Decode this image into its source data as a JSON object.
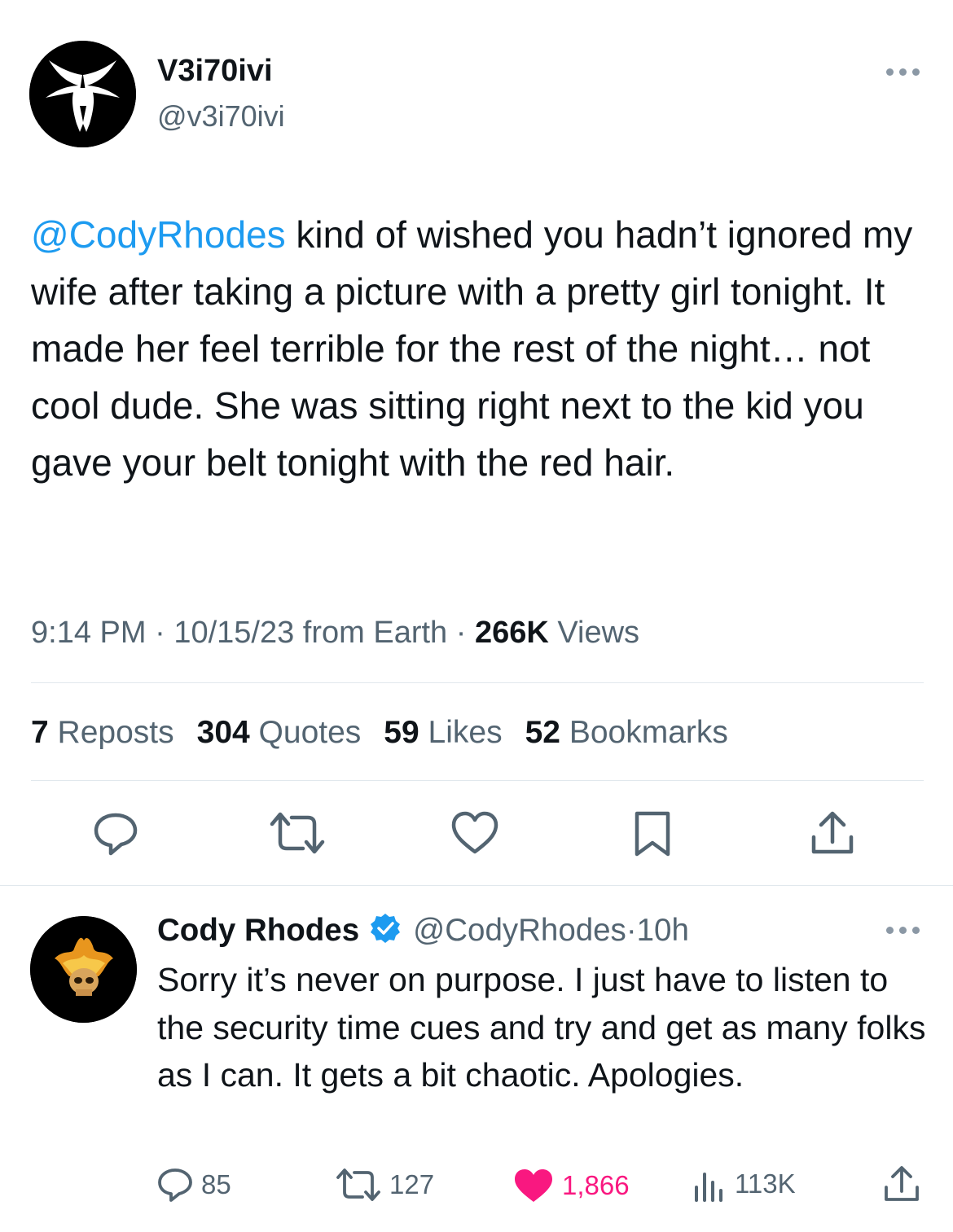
{
  "main_tweet": {
    "display_name": "V3i70ivi",
    "handle": "@v3i70ivi",
    "mention": "@CodyRhodes",
    "text": " kind of wished you hadn’t ignored my wife after taking a picture with a pretty girl tonight. It made her feel terrible for the rest of the night… not cool dude. She was sitting right next to the kid you gave your belt tonight with the red hair.",
    "time": "9:14 PM",
    "sep1": " · ",
    "date": "10/15/23",
    "source": " from Earth",
    "sep2": " · ",
    "views_count": "266K",
    "views_label": " Views",
    "stats": {
      "reposts_count": "7",
      "reposts_label": "Reposts",
      "quotes_count": "304",
      "quotes_label": "Quotes",
      "likes_count": "59",
      "likes_label": "Likes",
      "bookmarks_count": "52",
      "bookmarks_label": "Bookmarks"
    },
    "actions": [
      "reply-icon",
      "repost-icon",
      "like-icon",
      "bookmark-icon",
      "share-icon"
    ]
  },
  "reply": {
    "display_name": "Cody Rhodes",
    "verified": true,
    "handle": "@CodyRhodes",
    "sep": " · ",
    "time_ago": "10h",
    "text": "Sorry it’s never on purpose. I just have to listen to the security time cues and try and get as many folks as I can. It gets a bit chaotic. Apologies.",
    "replies": "85",
    "reposts": "127",
    "likes": "1,866",
    "views": "113K"
  },
  "colors": {
    "accent": "#1d9bf0",
    "like_active": "#f91880",
    "text": "#0f1419",
    "secondary": "#536471",
    "divider": "#e1e8ed"
  }
}
